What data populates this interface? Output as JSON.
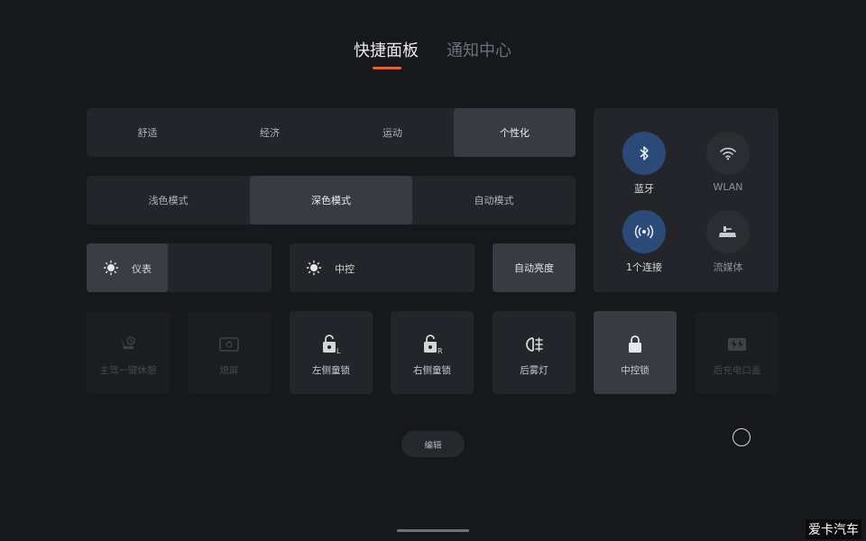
{
  "tabs": {
    "active": "快捷面板",
    "inactive": "通知中心"
  },
  "drive_modes": {
    "items": [
      "舒适",
      "经济",
      "运动",
      "个性化"
    ],
    "selected": "个性化"
  },
  "theme_modes": {
    "items": [
      "浅色模式",
      "深色模式",
      "自动模式"
    ],
    "selected": "深色模式"
  },
  "brightness": {
    "cluster_label": "仪表",
    "center_label": "中控",
    "auto_label": "自动亮度"
  },
  "connectivity": {
    "bluetooth": {
      "label": "蓝牙",
      "state": "on",
      "icon": "bluetooth-icon"
    },
    "wlan": {
      "label": "WLAN",
      "state": "off",
      "icon": "wifi-icon"
    },
    "hotspot": {
      "label": "1个连接",
      "state": "on",
      "icon": "hotspot-icon"
    },
    "streaming": {
      "label": "流媒体",
      "state": "off",
      "icon": "streaming-mirror-icon"
    }
  },
  "tiles": [
    {
      "label": "主驾一键休憩",
      "icon": "seat-recline-icon",
      "state": "disabled"
    },
    {
      "label": "熄屏",
      "icon": "screen-off-icon",
      "state": "disabled"
    },
    {
      "label": "左侧童锁",
      "icon": "child-lock-left-icon",
      "state": "normal"
    },
    {
      "label": "右侧童锁",
      "icon": "child-lock-right-icon",
      "state": "normal"
    },
    {
      "label": "后雾灯",
      "icon": "rear-fog-light-icon",
      "state": "normal"
    },
    {
      "label": "中控锁",
      "icon": "central-lock-icon",
      "state": "active"
    },
    {
      "label": "后充电口盖",
      "icon": "charge-port-icon",
      "state": "disabled"
    }
  ],
  "edit_label": "编辑",
  "watermark": "爱卡汽车",
  "colors": {
    "accent": "#e0643f",
    "toggle_on": "#2c4a78",
    "panel": "#23252a",
    "background": "#17181c"
  }
}
